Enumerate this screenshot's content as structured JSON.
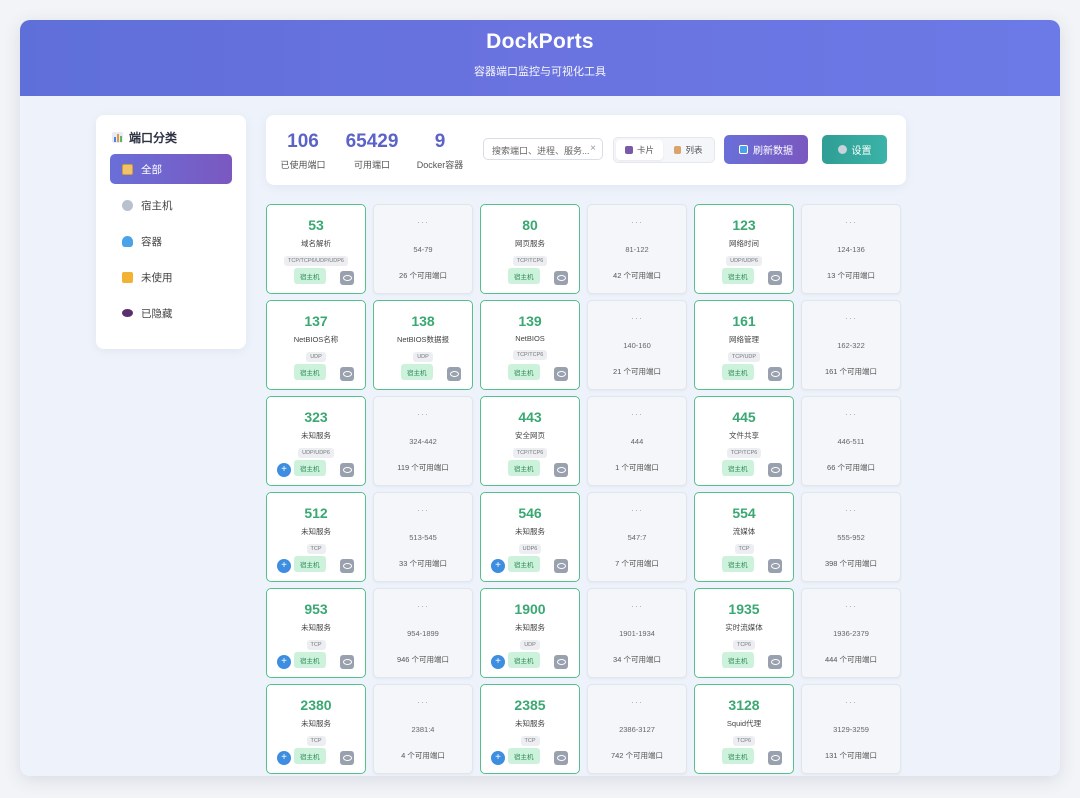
{
  "header": {
    "title": "DockPorts",
    "subtitle": "容器端口监控与可视化工具"
  },
  "sidebar": {
    "title": "端口分类",
    "items": [
      {
        "label": "全部",
        "icon": "clipboard-icon",
        "active": true
      },
      {
        "label": "宿主机",
        "icon": "gear-icon"
      },
      {
        "label": "容器",
        "icon": "whale-icon"
      },
      {
        "label": "未使用",
        "icon": "unlock-icon"
      },
      {
        "label": "已隐藏",
        "icon": "eye-icon"
      }
    ]
  },
  "stats": [
    {
      "value": "106",
      "label": "已使用端口"
    },
    {
      "value": "65429",
      "label": "可用端口"
    },
    {
      "value": "9",
      "label": "Docker容器"
    }
  ],
  "search": {
    "placeholder": "搜索端口、进程、服务..."
  },
  "view": {
    "card_label": "卡片",
    "list_label": "列表"
  },
  "buttons": {
    "refresh": "刷新数据",
    "settings": "设置"
  },
  "colors": {
    "accent": "#5b63c9",
    "used_border": "#56c08a",
    "settings": "#2f9e94"
  },
  "host_label": "宿主机",
  "cards": [
    {
      "type": "used",
      "port": "53",
      "service": "域名解析",
      "proto": "TCP/TCP6/UDP/UDP6",
      "plus": false
    },
    {
      "type": "free",
      "range": "54-79",
      "avail": "26 个可用端口"
    },
    {
      "type": "used",
      "port": "80",
      "service": "网页服务",
      "proto": "TCP/TCP6",
      "plus": false
    },
    {
      "type": "free",
      "range": "81-122",
      "avail": "42 个可用端口"
    },
    {
      "type": "used",
      "port": "123",
      "service": "网络时间",
      "proto": "UDP/UDP6",
      "plus": false
    },
    {
      "type": "free",
      "range": "124-136",
      "avail": "13 个可用端口"
    },
    {
      "type": "used",
      "port": "137",
      "service": "NetBIOS名称",
      "proto": "UDP",
      "plus": false
    },
    {
      "type": "used",
      "port": "138",
      "service": "NetBIOS数据报",
      "proto": "UDP",
      "plus": false
    },
    {
      "type": "used",
      "port": "139",
      "service": "NetBIOS",
      "proto": "TCP/TCP6",
      "plus": false
    },
    {
      "type": "free",
      "range": "140-160",
      "avail": "21 个可用端口"
    },
    {
      "type": "used",
      "port": "161",
      "service": "网络管理",
      "proto": "TCP/UDP",
      "plus": false
    },
    {
      "type": "free",
      "range": "162-322",
      "avail": "161 个可用端口"
    },
    {
      "type": "used",
      "port": "323",
      "service": "未知服务",
      "proto": "UDP/UDP6",
      "plus": true
    },
    {
      "type": "free",
      "range": "324-442",
      "avail": "119 个可用端口"
    },
    {
      "type": "used",
      "port": "443",
      "service": "安全网页",
      "proto": "TCP/TCP6",
      "plus": false
    },
    {
      "type": "free",
      "range": "444",
      "avail": "1 个可用端口"
    },
    {
      "type": "used",
      "port": "445",
      "service": "文件共享",
      "proto": "TCP/TCP6",
      "plus": false
    },
    {
      "type": "free",
      "range": "446-511",
      "avail": "66 个可用端口"
    },
    {
      "type": "used",
      "port": "512",
      "service": "未知服务",
      "proto": "TCP",
      "plus": true
    },
    {
      "type": "free",
      "range": "513-545",
      "avail": "33 个可用端口"
    },
    {
      "type": "used",
      "port": "546",
      "service": "未知服务",
      "proto": "UDP6",
      "plus": true
    },
    {
      "type": "free",
      "range": "547:7",
      "avail": "7 个可用端口"
    },
    {
      "type": "used",
      "port": "554",
      "service": "流媒体",
      "proto": "TCP",
      "plus": false
    },
    {
      "type": "free",
      "range": "555-952",
      "avail": "398 个可用端口"
    },
    {
      "type": "used",
      "port": "953",
      "service": "未知服务",
      "proto": "TCP",
      "plus": true
    },
    {
      "type": "free",
      "range": "954-1899",
      "avail": "946 个可用端口"
    },
    {
      "type": "used",
      "port": "1900",
      "service": "未知服务",
      "proto": "UDP",
      "plus": true
    },
    {
      "type": "free",
      "range": "1901-1934",
      "avail": "34 个可用端口"
    },
    {
      "type": "used",
      "port": "1935",
      "service": "实时流媒体",
      "proto": "TCP6",
      "plus": false
    },
    {
      "type": "free",
      "range": "1936-2379",
      "avail": "444 个可用端口"
    },
    {
      "type": "used",
      "port": "2380",
      "service": "未知服务",
      "proto": "TCP",
      "plus": true
    },
    {
      "type": "free",
      "range": "2381:4",
      "avail": "4 个可用端口"
    },
    {
      "type": "used",
      "port": "2385",
      "service": "未知服务",
      "proto": "TCP",
      "plus": true
    },
    {
      "type": "free",
      "range": "2386-3127",
      "avail": "742 个可用端口"
    },
    {
      "type": "used",
      "port": "3128",
      "service": "Squid代理",
      "proto": "TCP6",
      "plus": false
    },
    {
      "type": "free",
      "range": "3129-3259",
      "avail": "131 个可用端口"
    }
  ]
}
